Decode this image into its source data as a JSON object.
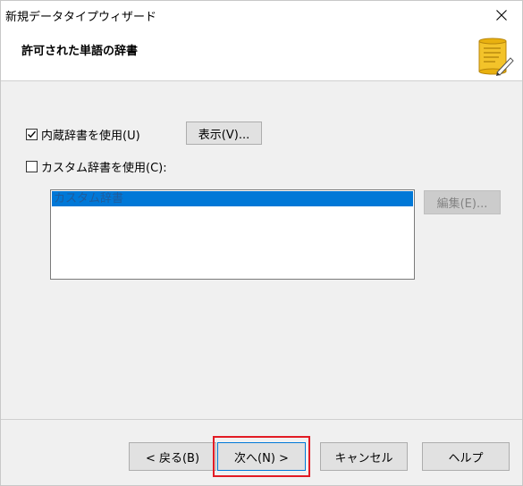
{
  "window": {
    "title": "新規データタイプウィザード"
  },
  "header": {
    "title": "許可された単語の辞書",
    "icon": "scroll-icon"
  },
  "builtin_dict": {
    "label": "内蔵辞書を使用(U)",
    "checked": true
  },
  "show_button": {
    "label": "表示(V)..."
  },
  "custom_dict": {
    "label": "カスタム辞書を使用(C):",
    "checked": false
  },
  "custom_list": {
    "items": [
      "カスタム辞書"
    ]
  },
  "edit_button": {
    "label": "編集(E)...",
    "enabled": false
  },
  "footer": {
    "back_label": "< 戻る(B)",
    "next_label": "次へ(N) >",
    "cancel_label": "キャンセル",
    "help_label": "ヘルプ"
  },
  "colors": {
    "selection": "#0078d7",
    "highlight_border": "#e21b24"
  }
}
